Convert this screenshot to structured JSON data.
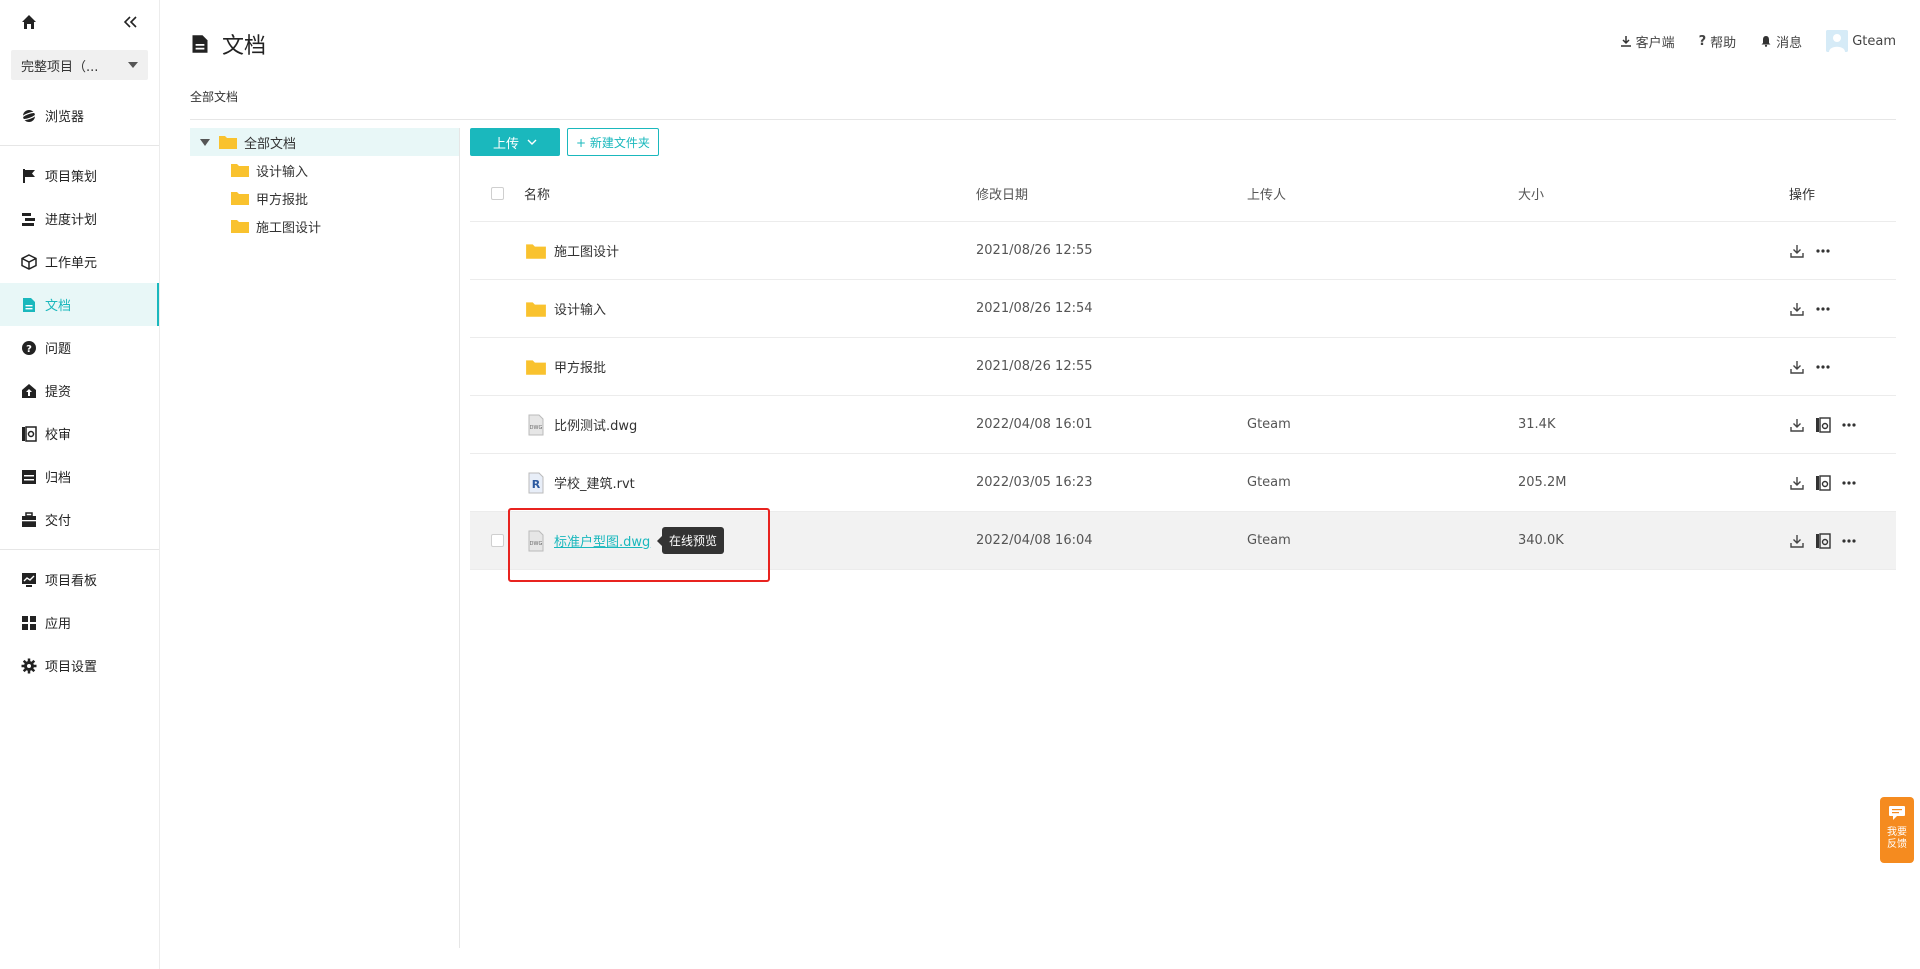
{
  "sidebar": {
    "project_select": "完整项目（...",
    "items": [
      {
        "label": "浏览器",
        "icon": "globe-icon"
      },
      {
        "label": "项目策划",
        "icon": "flag-icon"
      },
      {
        "label": "进度计划",
        "icon": "gantt-icon"
      },
      {
        "label": "工作单元",
        "icon": "cube-icon"
      },
      {
        "label": "文档",
        "icon": "document-icon"
      },
      {
        "label": "问题",
        "icon": "question-icon"
      },
      {
        "label": "提资",
        "icon": "submit-icon"
      },
      {
        "label": "校审",
        "icon": "review-icon"
      },
      {
        "label": "归档",
        "icon": "archive-icon"
      },
      {
        "label": "交付",
        "icon": "briefcase-icon"
      },
      {
        "label": "项目看板",
        "icon": "dashboard-icon"
      },
      {
        "label": "应用",
        "icon": "apps-icon"
      },
      {
        "label": "项目设置",
        "icon": "gear-icon"
      }
    ]
  },
  "header": {
    "title": "文档",
    "client": "客户端",
    "help": "帮助",
    "messages": "消息",
    "user": "Gteam"
  },
  "breadcrumb": "全部文档",
  "tree": {
    "root": "全部文档",
    "children": [
      "设计输入",
      "甲方报批",
      "施工图设计"
    ]
  },
  "toolbar": {
    "upload": "上传",
    "new_folder": "+ 新建文件夹"
  },
  "table": {
    "headers": {
      "name": "名称",
      "date": "修改日期",
      "uploader": "上传人",
      "size": "大小",
      "ops": "操作"
    },
    "rows": [
      {
        "name": "施工图设计",
        "type": "folder",
        "date": "2021/08/26 12:55",
        "uploader": "",
        "size": ""
      },
      {
        "name": "设计输入",
        "type": "folder",
        "date": "2021/08/26 12:54",
        "uploader": "",
        "size": ""
      },
      {
        "name": "甲方报批",
        "type": "folder",
        "date": "2021/08/26 12:55",
        "uploader": "",
        "size": ""
      },
      {
        "name": "比例测试.dwg",
        "type": "dwg",
        "date": "2022/04/08 16:01",
        "uploader": "Gteam",
        "size": "31.4K"
      },
      {
        "name": "学校_建筑.rvt",
        "type": "rvt",
        "date": "2022/03/05 16:23",
        "uploader": "Gteam",
        "size": "205.2M"
      },
      {
        "name": "标准户型图.dwg",
        "type": "dwg",
        "date": "2022/04/08 16:04",
        "uploader": "Gteam",
        "size": "340.0K"
      }
    ]
  },
  "tooltip": "在线预览",
  "feedback": {
    "line1": "我要",
    "line2": "反馈"
  },
  "colors": {
    "accent": "#1ab8bd",
    "highlight": "#e8231f",
    "folder": "#f9c22e",
    "feedback": "#f58b1f"
  }
}
